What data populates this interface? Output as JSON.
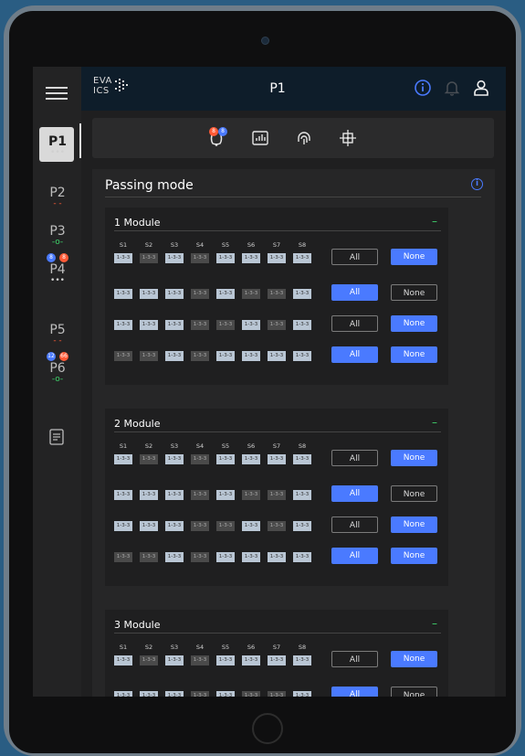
{
  "header": {
    "logo_line1": "EVA",
    "logo_line2": "ICS",
    "title": "P1"
  },
  "sidebar": {
    "items": [
      {
        "label": "P1",
        "sub": "•••",
        "sub_color": "#d0d0d0",
        "active": true
      },
      {
        "label": "P2",
        "sub": "- -",
        "sub_color": "#ff5a36"
      },
      {
        "label": "P3",
        "sub": "-o-",
        "sub_color": "#3fd36b"
      },
      {
        "label": "P4",
        "sub": "•••",
        "sub_color": "#d0d0d0",
        "badge_blue": "8",
        "badge_red": "8"
      },
      {
        "label": "P5",
        "sub": "- -",
        "sub_color": "#ff5a36"
      },
      {
        "label": "P6",
        "sub": "-o-",
        "sub_color": "#3fd36b",
        "badge_blue": "12",
        "badge_red": "66"
      }
    ]
  },
  "toolbar": {
    "alarm_badge_red": "8",
    "alarm_badge_blue": "8"
  },
  "panel": {
    "title": "Passing mode"
  },
  "modules": [
    {
      "title": "1 Module",
      "rows": [
        {
          "cells": [
            1,
            0,
            1,
            0,
            1,
            1,
            1,
            1
          ],
          "all": "outline",
          "none": "fill"
        },
        {
          "cells": [
            1,
            1,
            1,
            0,
            1,
            0,
            0,
            1
          ],
          "all": "fill",
          "none": "outline"
        },
        {
          "cells": [
            1,
            1,
            1,
            0,
            0,
            1,
            0,
            1
          ],
          "all": "outline",
          "none": "fill"
        },
        {
          "cells": [
            0,
            0,
            1,
            0,
            1,
            1,
            1,
            1
          ],
          "all": "fill",
          "none": "fill"
        }
      ]
    },
    {
      "title": "2 Module",
      "rows": [
        {
          "cells": [
            1,
            0,
            1,
            0,
            1,
            1,
            1,
            1
          ],
          "all": "outline",
          "none": "fill"
        },
        {
          "cells": [
            1,
            1,
            1,
            0,
            1,
            0,
            0,
            1
          ],
          "all": "fill",
          "none": "outline"
        },
        {
          "cells": [
            1,
            1,
            1,
            0,
            0,
            1,
            0,
            1
          ],
          "all": "outline",
          "none": "fill"
        },
        {
          "cells": [
            0,
            0,
            1,
            0,
            1,
            1,
            1,
            1
          ],
          "all": "fill",
          "none": "fill"
        }
      ]
    },
    {
      "title": "3 Module",
      "rows": [
        {
          "cells": [
            1,
            0,
            1,
            0,
            1,
            1,
            1,
            1
          ],
          "all": "outline",
          "none": "fill"
        },
        {
          "cells": [
            1,
            1,
            1,
            0,
            1,
            0,
            0,
            1
          ],
          "all": "fill",
          "none": "outline"
        }
      ]
    }
  ],
  "labels": {
    "slots": [
      "S1",
      "S2",
      "S3",
      "S4",
      "S5",
      "S6",
      "S7",
      "S8"
    ],
    "cell_text": "1-3-3",
    "all_label": "All",
    "none_label": "None"
  },
  "colors": {
    "accent": "#4a7aff",
    "green": "#3fd36b",
    "red": "#ff5a36"
  }
}
